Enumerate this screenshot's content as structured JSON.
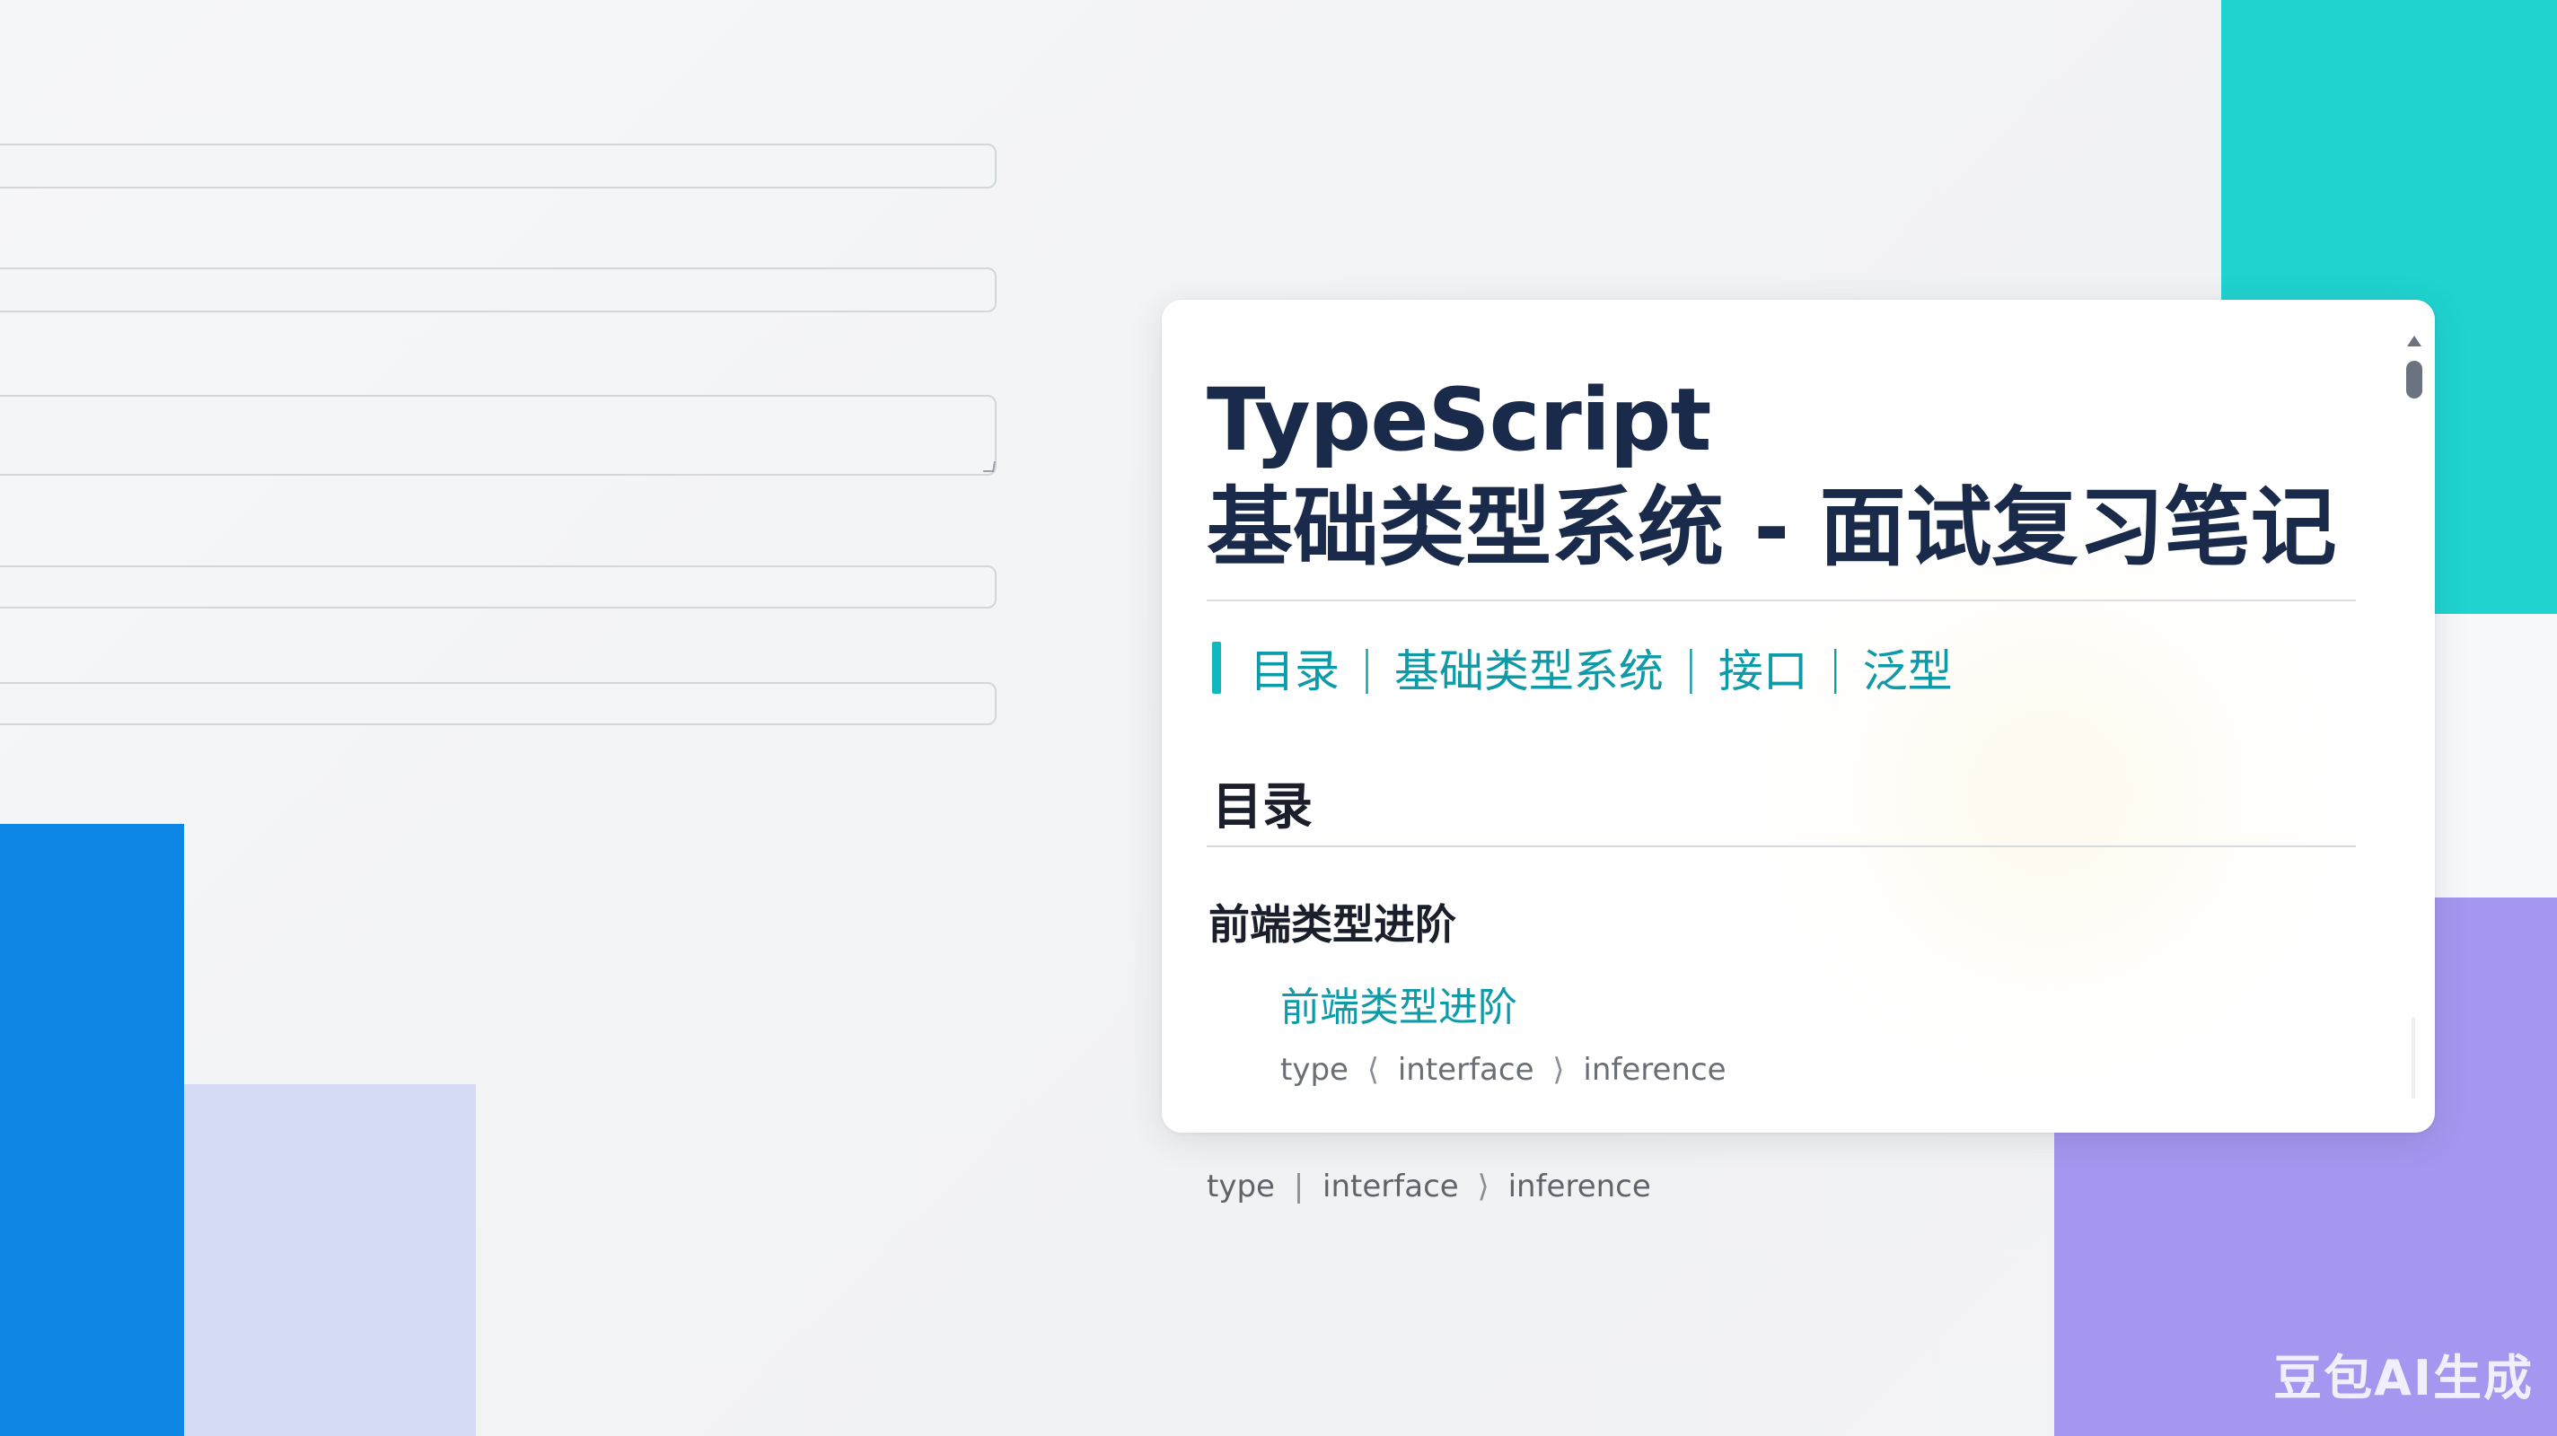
{
  "form": {
    "field_1_value": "",
    "field_2_value": "",
    "field_3_value": "",
    "field_4_value": "",
    "field_5_value": ""
  },
  "card": {
    "title_line_1": "TypeScript",
    "title_line_2": "基础类型系统 - 面试复习笔记",
    "nav": {
      "items": [
        "目录",
        "基础类型系统",
        "接口",
        "泛型"
      ],
      "separator": "|"
    },
    "section_heading": "目录",
    "subheading": "前端类型进阶",
    "entry": {
      "link": "前端类型进阶",
      "tags": [
        "type",
        "interface",
        "inference"
      ],
      "tag_separators": [
        "⟨",
        "⟩"
      ]
    }
  },
  "caption": {
    "tags": [
      "type",
      "interface",
      "inference"
    ],
    "tag_separators": [
      "|",
      "⟩"
    ]
  },
  "watermark": "豆包AI生成",
  "colors": {
    "teal_block": "#1fd3cf",
    "purple_block": "#a596ef",
    "blue_block": "#0e86e6",
    "lavender_block": "#d6dbf5",
    "title": "#1a2a4a",
    "accent": "#0e9aa7"
  }
}
